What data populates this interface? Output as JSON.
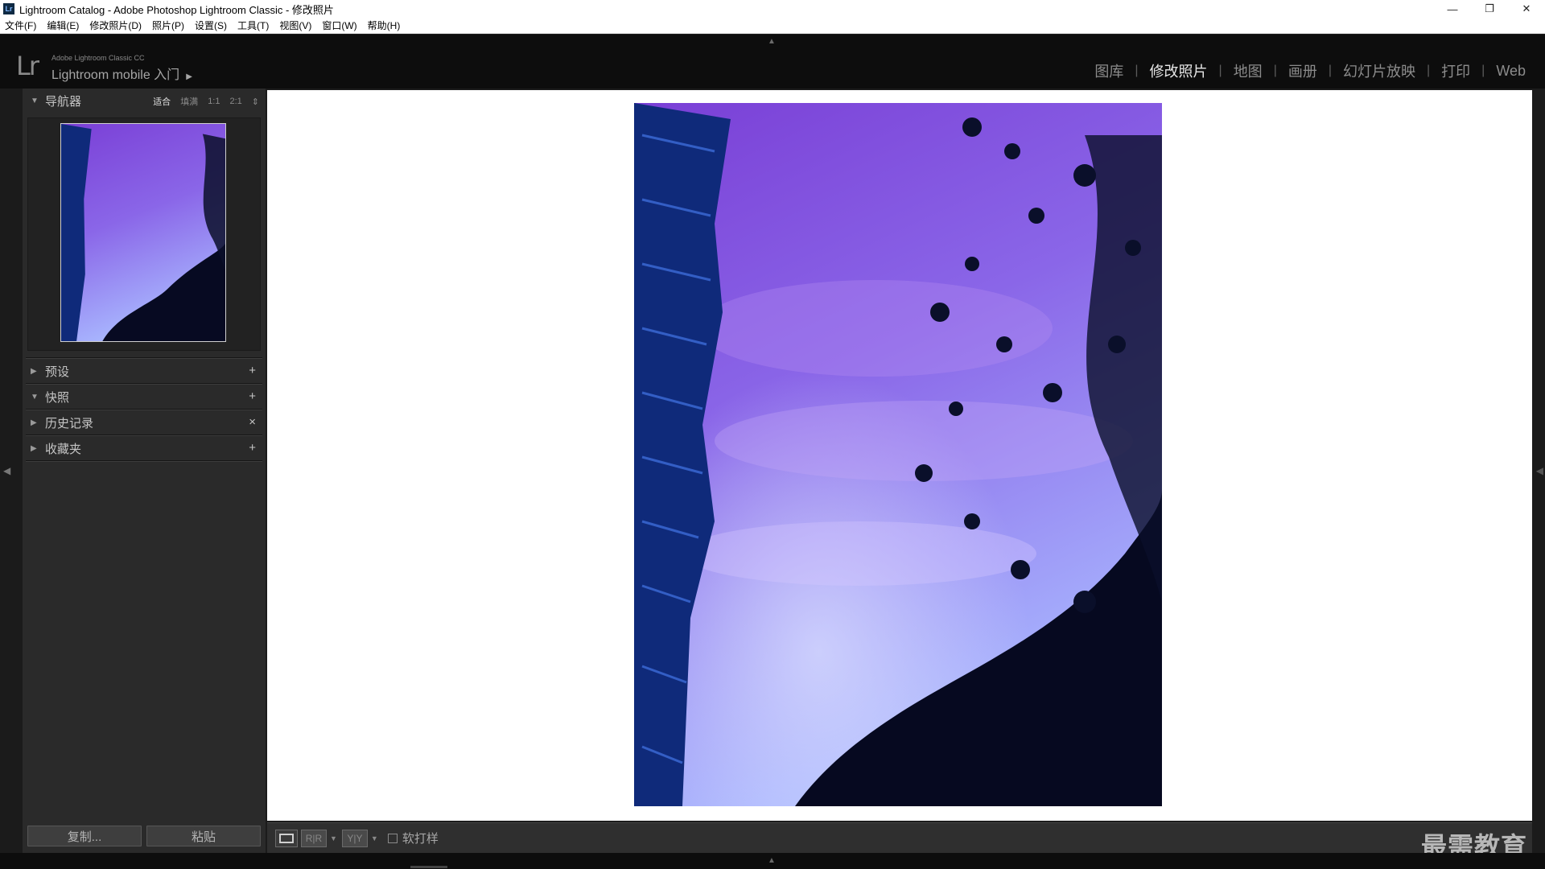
{
  "window": {
    "title": "Lightroom Catalog - Adobe Photoshop Lightroom Classic - 修改照片",
    "app_icon_text": "Lr",
    "controls": [
      "—",
      "❐",
      "✕"
    ]
  },
  "menu": [
    "文件(F)",
    "编辑(E)",
    "修改照片(D)",
    "照片(P)",
    "设置(S)",
    "工具(T)",
    "视图(V)",
    "窗口(W)",
    "帮助(H)"
  ],
  "brand": {
    "logo": "Lr",
    "small": "Adobe Lightroom Classic CC",
    "main": "Lightroom mobile 入门",
    "arrow": "▶"
  },
  "modules": [
    {
      "label": "图库",
      "active": false
    },
    {
      "label": "修改照片",
      "active": true
    },
    {
      "label": "地图",
      "active": false
    },
    {
      "label": "画册",
      "active": false
    },
    {
      "label": "幻灯片放映",
      "active": false
    },
    {
      "label": "打印",
      "active": false
    },
    {
      "label": "Web",
      "active": false
    }
  ],
  "navigator": {
    "title": "导航器",
    "zoom": {
      "fit": "适合",
      "fill": "填满",
      "one": "1:1",
      "two": "2:1"
    }
  },
  "panels": {
    "presets": {
      "title": "预设",
      "action": "+"
    },
    "snapshots": {
      "title": "快照",
      "action": "+"
    },
    "history": {
      "title": "历史记录",
      "action": "×"
    },
    "collections": {
      "title": "收藏夹",
      "action": "+"
    }
  },
  "buttons": {
    "copy": "复制...",
    "paste": "粘贴"
  },
  "toolbar": {
    "compare_label": "R|R",
    "before_after_label": "Y|Y",
    "softproof_label": "软打样"
  },
  "watermark": "最需教育",
  "colors": {
    "sky_top": "#7a3fd6",
    "sky_mid": "#8a66e8",
    "sky_bottom": "#a9b8ff",
    "building": "#0f2a7a"
  }
}
